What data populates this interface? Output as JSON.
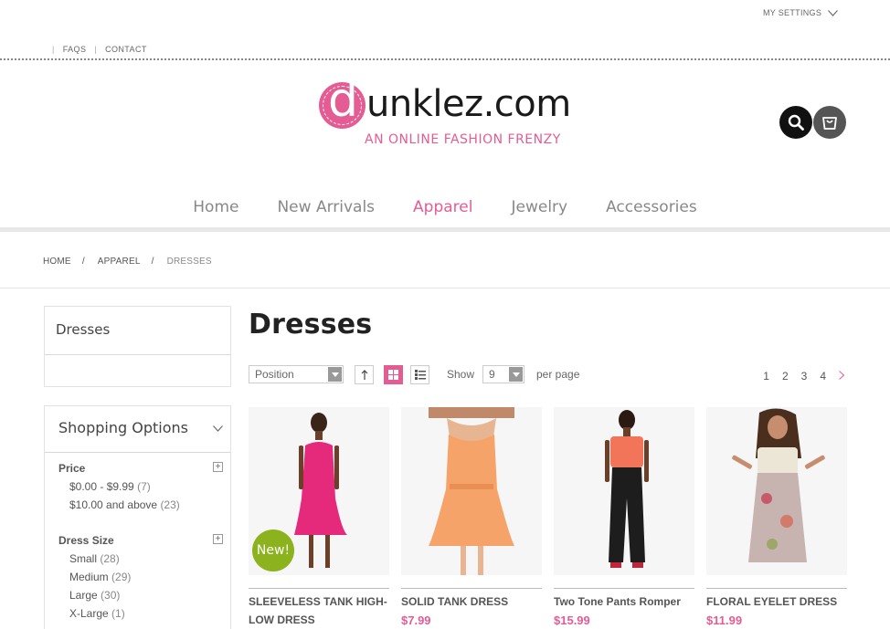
{
  "header": {
    "settings_label": "MY SETTINGS",
    "links": [
      "FAQS",
      "CONTACT"
    ],
    "logo_text": "unklez.com",
    "logo_letter": "d",
    "tagline": "AN ONLINE FASHION FRENZY"
  },
  "nav": {
    "items": [
      "Home",
      "New Arrivals",
      "Apparel",
      "Jewelry",
      "Accessories"
    ],
    "active": "Apparel"
  },
  "breadcrumb": [
    "HOME",
    "APPAREL",
    "DRESSES"
  ],
  "sidebar": {
    "category_title": "Dresses",
    "options_title": "Shopping Options",
    "filters": [
      {
        "title": "Price",
        "items": [
          {
            "label": "$0.00 - $9.99",
            "count": "(7)"
          },
          {
            "label": "$10.00 and above",
            "count": "(23)"
          }
        ]
      },
      {
        "title": "Dress Size",
        "items": [
          {
            "label": "Small",
            "count": "(28)"
          },
          {
            "label": "Medium",
            "count": "(29)"
          },
          {
            "label": "Large",
            "count": "(30)"
          },
          {
            "label": "X-Large",
            "count": "(1)"
          }
        ]
      }
    ]
  },
  "main": {
    "title": "Dresses",
    "sort_value": "Position",
    "show_label": "Show",
    "per_page_value": "9",
    "per_page_label": "per page",
    "pages": [
      "1",
      "2",
      "3",
      "4"
    ]
  },
  "products": [
    {
      "name": "SLEEVELESS TANK HIGH-LOW DRESS",
      "price": "",
      "badge": "New!"
    },
    {
      "name": "SOLID TANK DRESS",
      "price": "$7.99"
    },
    {
      "name": "Two Tone Pants Romper",
      "price": "$15.99"
    },
    {
      "name": "FLORAL EYELET DRESS",
      "price": "$11.99"
    }
  ],
  "colors": {
    "accent": "#e55c94",
    "badge": "#8cb21d"
  }
}
